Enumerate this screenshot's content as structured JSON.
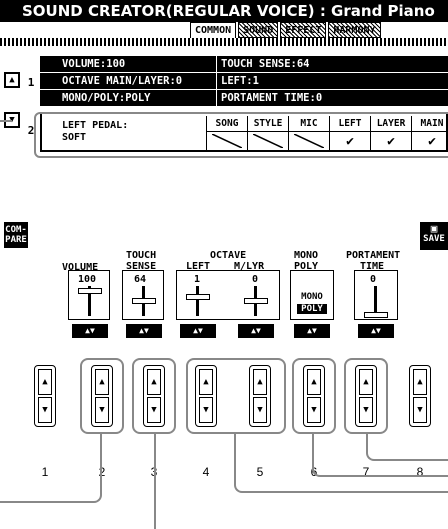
{
  "header": {
    "title": "SOUND CREATOR(REGULAR VOICE) : Grand Piano"
  },
  "tabs": [
    {
      "label": "COMMON"
    },
    {
      "label": "SOUND"
    },
    {
      "label": "EFFECT"
    },
    {
      "label": "HARMONY"
    }
  ],
  "page_buttons": {
    "up": "▲",
    "down": "▼"
  },
  "rows": {
    "row1_num": "1",
    "row2_num": "2",
    "params": [
      {
        "left": "VOLUME:100",
        "right": "TOUCH SENSE:64"
      },
      {
        "left": "OCTAVE MAIN/LAYER:0",
        "right": "LEFT:1"
      },
      {
        "left": "MONO/POLY:POLY",
        "right": "PORTAMENT TIME:0"
      }
    ]
  },
  "pedal": {
    "label_line1": "LEFT PEDAL:",
    "label_line2": "SOFT",
    "columns": [
      "SONG",
      "STYLE",
      "MIC",
      "LEFT",
      "LAYER",
      "MAIN"
    ],
    "checked": [
      false,
      false,
      false,
      true,
      true,
      true
    ]
  },
  "compare": {
    "label_line1": "COM-",
    "label_line2": "PARE"
  },
  "save": {
    "label": "SAVE"
  },
  "sliders": {
    "volume": {
      "label": "VOLUME",
      "value": "100"
    },
    "touch": {
      "label_line1": "TOUCH",
      "label_line2": "SENSE",
      "value": "64"
    },
    "octave": {
      "group_label": "OCTAVE",
      "left_label": "LEFT",
      "left_value": "1",
      "mlyr_label": "M/LYR",
      "mlyr_value": "0"
    },
    "mono": {
      "label_line1": "MONO",
      "label_line2": "POLY",
      "option_mono": "MONO",
      "option_poly": "POLY"
    },
    "portament": {
      "label_line1": "PORTAMENT",
      "label_line2": "TIME",
      "value": "0"
    }
  },
  "physical_buttons": [
    "1",
    "2",
    "3",
    "4",
    "5",
    "6",
    "7",
    "8"
  ],
  "glyphs": {
    "up": "▲",
    "down": "▼",
    "check": "✔"
  }
}
